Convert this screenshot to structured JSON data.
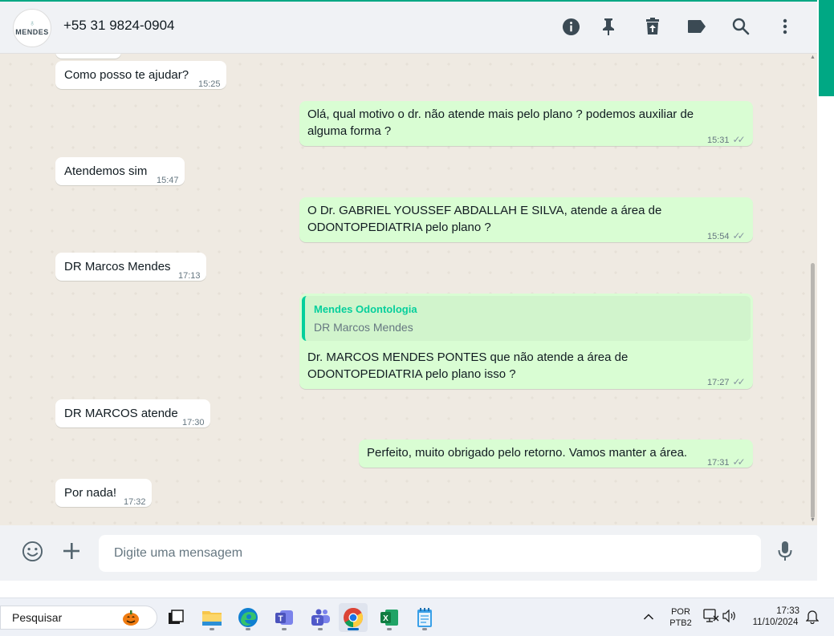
{
  "header": {
    "avatar_text": "MENDES",
    "contact_name": "+55 31 9824-0904",
    "icons": [
      "info-icon",
      "pin-icon",
      "delete-icon",
      "label-icon",
      "search-icon",
      "menu-icon"
    ]
  },
  "messages": [
    {
      "dir": "in",
      "text": "Como posso te ajudar?",
      "time": "15:25"
    },
    {
      "dir": "out",
      "text": "Olá, qual motivo o dr. não atende mais pelo plano ? podemos auxiliar de alguma forma ?",
      "time": "15:31"
    },
    {
      "dir": "in",
      "text": "Atendemos sim",
      "time": "15:47"
    },
    {
      "dir": "out",
      "text": "O Dr. GABRIEL YOUSSEF ABDALLAH E SILVA, atende a área de ODONTOPEDIATRIA pelo plano ?",
      "time": "15:54"
    },
    {
      "dir": "in",
      "text": "DR Marcos Mendes",
      "time": "17:13"
    },
    {
      "dir": "out",
      "quote_author": "Mendes Odontologia",
      "quote_text": "DR Marcos Mendes",
      "text": "Dr. MARCOS MENDES PONTES que não atende a área de ODONTOPEDIATRIA pelo plano isso ?",
      "time": "17:27"
    },
    {
      "dir": "in",
      "text": "DR MARCOS atende",
      "time": "17:30"
    },
    {
      "dir": "out",
      "text": "Perfeito, muito obrigado pelo retorno. Vamos manter a área.",
      "time": "17:31"
    },
    {
      "dir": "in",
      "text": "Por nada!",
      "time": "17:32"
    }
  ],
  "composer": {
    "placeholder": "Digite uma mensagem"
  },
  "taskbar": {
    "search_label": "Pesquisar",
    "apps": [
      "task-view",
      "file-explorer",
      "edge",
      "teams-classic",
      "teams",
      "chrome",
      "excel",
      "notepad"
    ],
    "active_app": "chrome",
    "language_line1": "POR",
    "language_line2": "PTB2",
    "time": "17:33",
    "date": "11/10/2024"
  },
  "colors": {
    "outgoing_bubble": "#d9fdd3",
    "incoming_bubble": "#ffffff",
    "accent": "#00a884",
    "quote_accent": "#06cf9c"
  }
}
